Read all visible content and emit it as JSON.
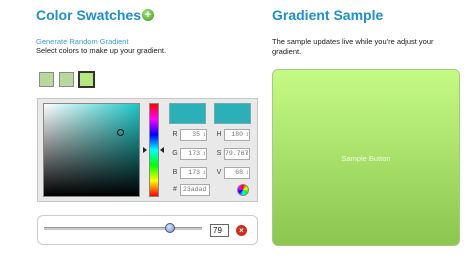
{
  "swatches_section": {
    "title": "Color Swatches",
    "add_icon": "+",
    "generate_link": "Generate Random Gradient",
    "instruction": "Select colors to make up your gradient.",
    "swatch_colors": [
      "#b9d89c",
      "#b9d89c",
      "#b7e880"
    ]
  },
  "picker": {
    "labels": {
      "r": "R",
      "g": "G",
      "b": "B",
      "h": "H",
      "s": "S",
      "v": "V",
      "hex": "#"
    },
    "values": {
      "r": "35",
      "g": "173",
      "b": "173",
      "h": "180",
      "s": "79.767",
      "v": "68"
    },
    "hex": "23adad",
    "current_color": "#2ab0b6",
    "previous_color": "#2ab0b6"
  },
  "slider": {
    "value": "79",
    "remove_icon": "×"
  },
  "gradient_section": {
    "title": "Gradient Sample",
    "description": "The sample updates live while you're adjust your gradient.",
    "sample_button": "Sample Button",
    "gradient_top": "#c5fb84",
    "gradient_bottom": "#8bc64f"
  }
}
